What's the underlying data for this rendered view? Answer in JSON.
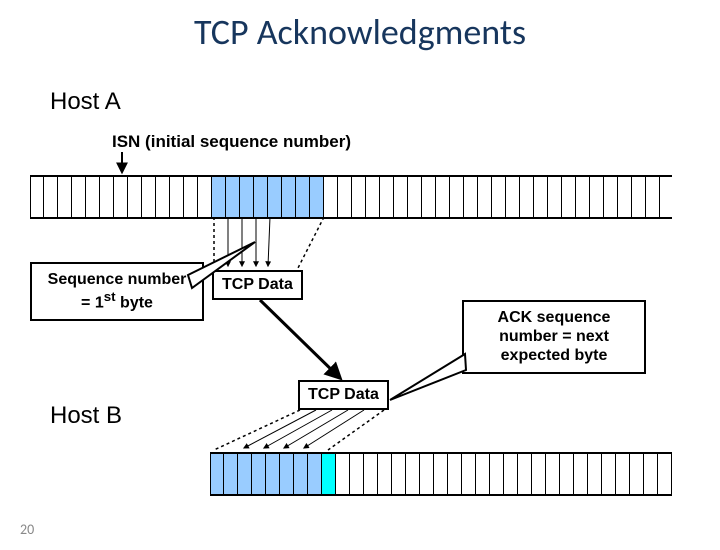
{
  "slide": {
    "title": "TCP Acknowledgments",
    "hostA": "Host A",
    "hostB": "Host B",
    "isn": "ISN (initial sequence number)",
    "seqNote": "Sequence number = 1",
    "seqNoteSup": "st",
    "seqNoteTail": " byte",
    "tcpData1": "TCP Data",
    "tcpData2": "TCP Data",
    "ackNote": "ACK sequence number = next expected byte",
    "pageNum": "20"
  }
}
